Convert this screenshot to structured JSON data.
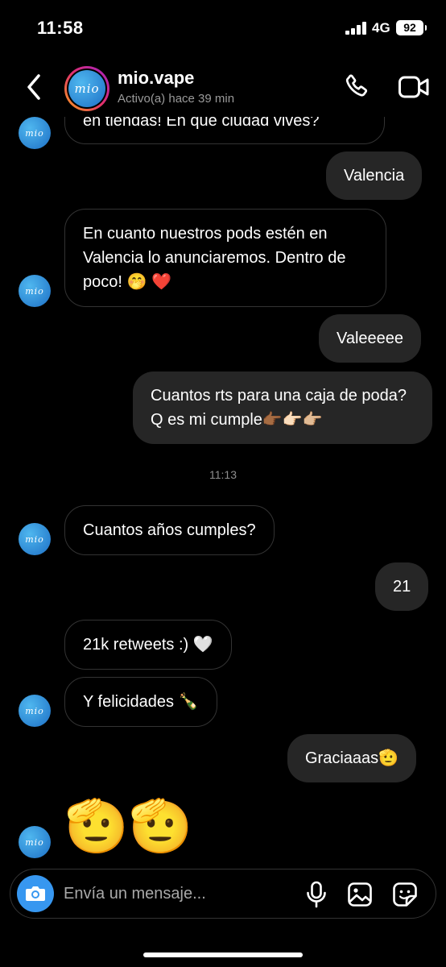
{
  "status_bar": {
    "time": "11:58",
    "network": "4G",
    "battery": "92"
  },
  "header": {
    "username": "mio.vape",
    "active_status": "Activo(a) hace 39 min",
    "avatar_logo": "mio",
    "icons": [
      "back-chevron-icon",
      "phone-icon",
      "video-camera-icon"
    ]
  },
  "messages": [
    {
      "dir": "in",
      "text": "en tiendas! En que ciudad vives?"
    },
    {
      "dir": "out",
      "text": "Valencia"
    },
    {
      "dir": "in",
      "text": "En cuanto nuestros pods estén en Valencia lo anunciaremos. Dentro de poco! 🤭 ❤️"
    },
    {
      "dir": "out",
      "text": "Valeeeee"
    },
    {
      "dir": "out",
      "text": "Cuantos rts para una caja de poda? Q es mi cumple👉🏾👉🏻👉🏼"
    },
    {
      "dir": "in",
      "text": "Cuantos años cumples?"
    },
    {
      "dir": "out",
      "text": "21"
    },
    {
      "dir": "in",
      "text": "21k retweets :) 🤍"
    },
    {
      "dir": "in",
      "text": "Y felicidades 🍾"
    },
    {
      "dir": "out",
      "text": "Graciaaas🫡"
    },
    {
      "dir": "in",
      "text": "🫡🫡"
    }
  ],
  "timestamp": "11:13",
  "composer": {
    "placeholder": "Envía un mensaje...",
    "icons": [
      "camera-icon",
      "microphone-icon",
      "gallery-icon",
      "sticker-icon"
    ]
  },
  "colors": {
    "accent": "#3797f0",
    "outgoing_bubble": "#262626",
    "incoming_border": "#333333"
  }
}
